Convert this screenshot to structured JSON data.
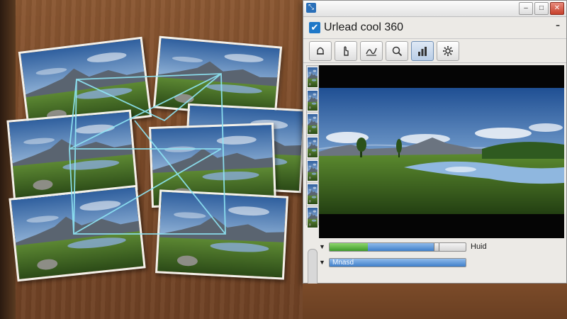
{
  "window": {
    "app_title": "Urlead cool 360",
    "menu_glyph": "⁃"
  },
  "toolbar": {
    "tools": [
      {
        "icon": "bell-icon"
      },
      {
        "icon": "hand-pointer-icon"
      },
      {
        "icon": "curve-tool-icon"
      },
      {
        "icon": "search-icon"
      },
      {
        "icon": "bar-chart-icon",
        "active": true
      },
      {
        "icon": "gear-icon"
      }
    ]
  },
  "controls": {
    "slider1": {
      "label": "Huid",
      "green_fill": 0.28,
      "blue_end": 0.78
    },
    "slider2": {
      "field_text": "Mnasd",
      "blue_fill": 1.0
    }
  },
  "colors": {
    "accent": "#1f78c8",
    "progress_green": "#3e9a2a",
    "progress_blue": "#3f7fc9"
  }
}
